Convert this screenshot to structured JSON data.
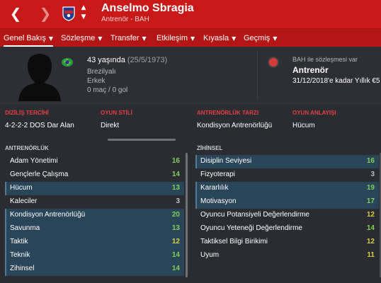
{
  "header": {
    "name": "Anselmo Sbragia",
    "subtitle": "Antrenör - BAH",
    "back_icon": "back-arrow",
    "forward_icon": "forward-arrow",
    "accent": "#c81919"
  },
  "tabs": [
    {
      "label": "Genel Bakış",
      "active": true
    },
    {
      "label": "Sözleşme"
    },
    {
      "label": "Transfer"
    },
    {
      "label": "Etkileşim"
    },
    {
      "label": "Kıyasla"
    },
    {
      "label": "Geçmiş"
    }
  ],
  "profile": {
    "age_text": "43 yaşında",
    "dob_text": "(25/5/1973)",
    "nationality": "Brezilyalı",
    "gender": "Erkek",
    "stats": "0 maç / 0 gol",
    "contract_label": "BAH ile sözleşmesi var",
    "role": "Antrenör",
    "contract_until": "31/12/2018'e kadar Yıllık €5"
  },
  "strip": {
    "formation_h": "DİZİLİŞ TERCİHİ",
    "formation_v": "4-2-2-2 DOS Dar Alan",
    "style_h": "OYUN STİLİ",
    "style_v": "Direkt",
    "coach_style_h": "ANTRENÖRLÜK TARZI",
    "coach_style_v": "Kondisyon Antrenörlüğü",
    "philosophy_h": "OYUN ANLAYIŞI",
    "philosophy_v": "Hücum"
  },
  "coaching": {
    "title": "ANTRENÖRLÜK",
    "rows": [
      {
        "label": "Adam Yönetimi",
        "value": "16"
      },
      {
        "label": "Gençlerle Çalışma",
        "value": "14"
      },
      {
        "label": "Hücum",
        "value": "13"
      },
      {
        "label": "Kaleciler",
        "value": "3"
      },
      {
        "label": "Kondisyon Antrenörlüğü",
        "value": "20"
      },
      {
        "label": "Savunma",
        "value": "13"
      },
      {
        "label": "Taktik",
        "value": "12"
      },
      {
        "label": "Teknik",
        "value": "14"
      },
      {
        "label": "Zihinsel",
        "value": "14"
      }
    ]
  },
  "mental": {
    "title": "ZİHİNSEL",
    "rows": [
      {
        "label": "Disiplin Seviyesi",
        "value": "16"
      },
      {
        "label": "Fizyoterapi",
        "value": "3"
      },
      {
        "label": "Kararlılık",
        "value": "19"
      },
      {
        "label": "Motivasyon",
        "value": "17"
      },
      {
        "label": "Oyuncu Potansiyeli Değerlendirme",
        "value": "12"
      },
      {
        "label": "Oyuncu Yeteneği Değerlendirme",
        "value": "14"
      },
      {
        "label": "Taktiksel Bilgi Birikimi",
        "value": "12"
      },
      {
        "label": "Uyum",
        "value": "11"
      }
    ]
  },
  "colors": {
    "high": "#7fd05a",
    "mid": "#d9d04a",
    "low": "#bfc1c4",
    "highlight_row": "#2b4558"
  }
}
